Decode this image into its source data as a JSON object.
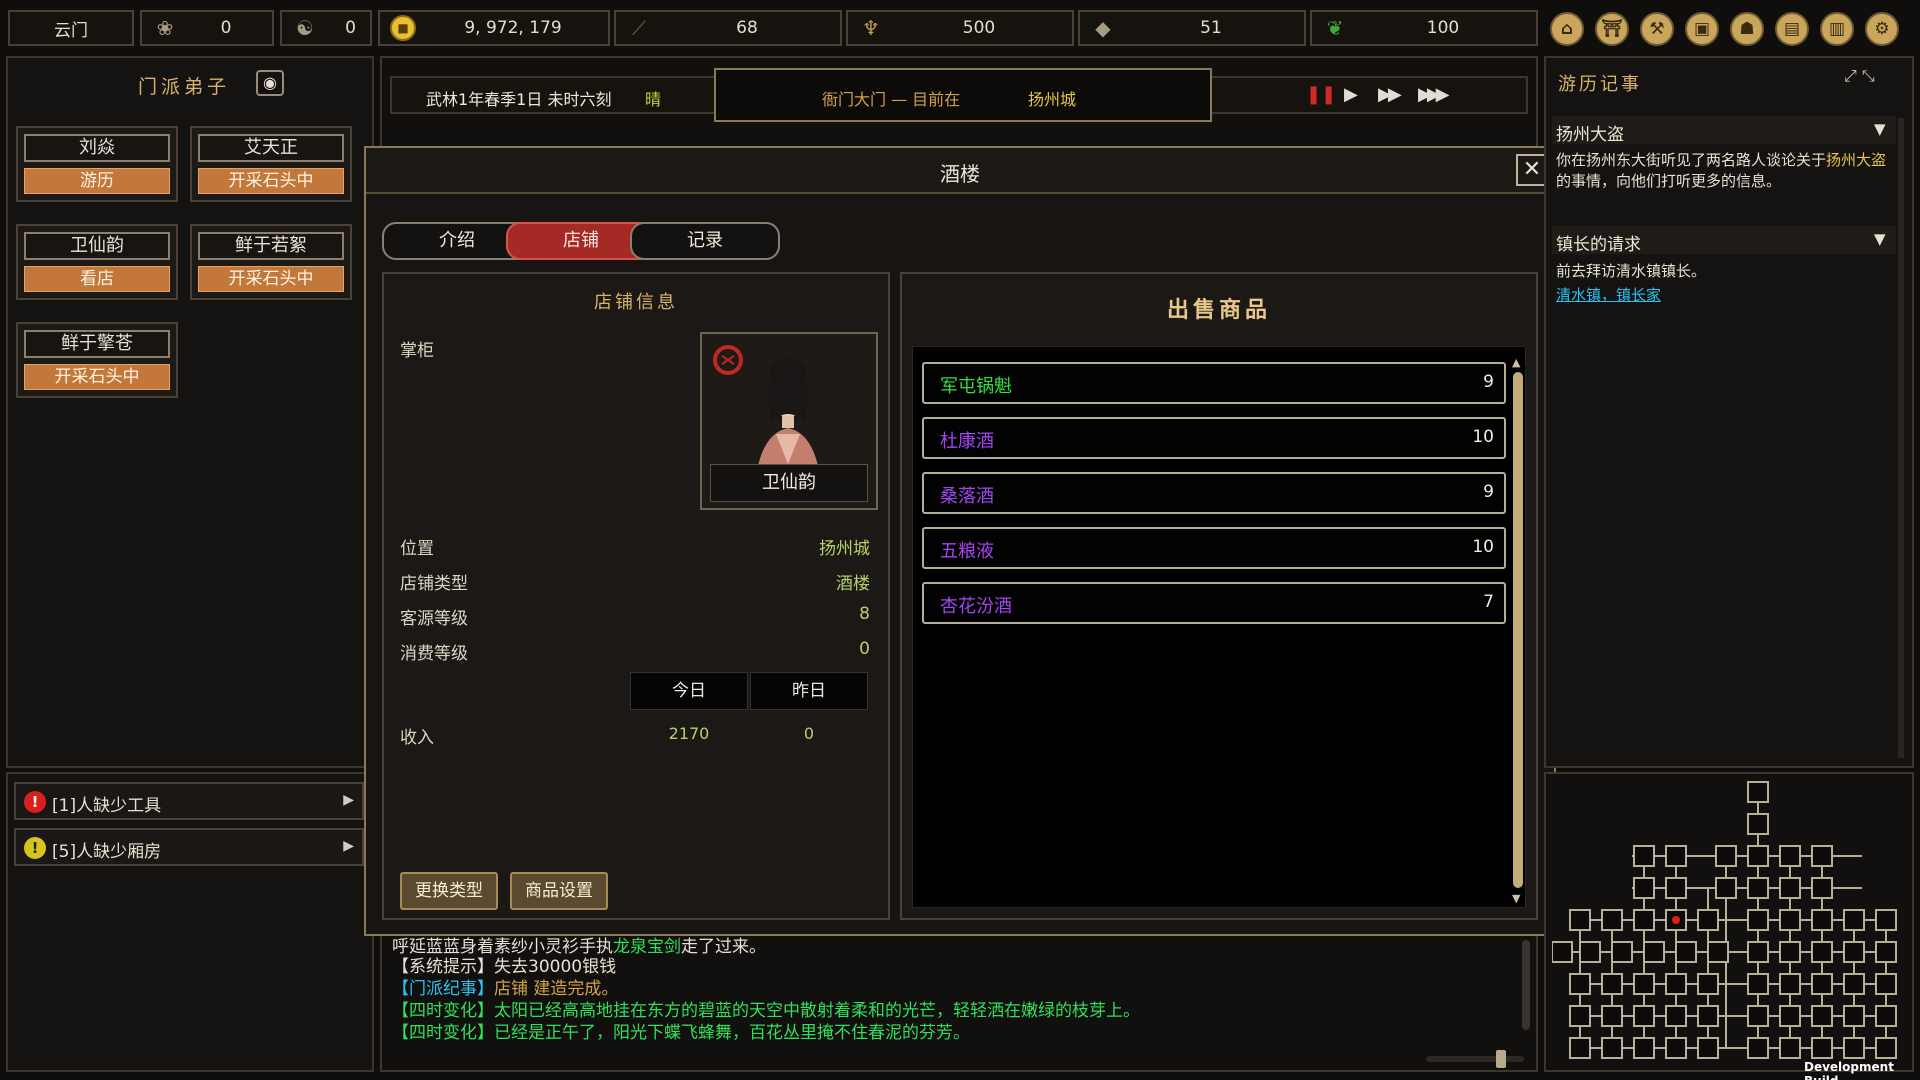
{
  "topbar": {
    "sect_name": "云门",
    "resources": [
      {
        "icon": "reputation-icon",
        "value": "0"
      },
      {
        "icon": "yinyang-icon",
        "value": "0"
      },
      {
        "icon": "coin-icon",
        "value": "9, 972, 179"
      },
      {
        "icon": "wood-icon",
        "value": "68"
      },
      {
        "icon": "grain-icon",
        "value": "500"
      },
      {
        "icon": "ore-icon",
        "value": "51"
      },
      {
        "icon": "herb-icon",
        "value": "100"
      }
    ],
    "menu_icons": [
      "sect-icon",
      "building-icon",
      "craft-icon",
      "map-icon",
      "bag-icon",
      "book-icon",
      "manual-icon",
      "settings-icon"
    ]
  },
  "disciples": {
    "title": "门派弟子",
    "items": [
      {
        "name": "刘焱",
        "status": "游历"
      },
      {
        "name": "艾天正",
        "status": "开采石头中"
      },
      {
        "name": "卫仙韵",
        "status": "看店"
      },
      {
        "name": "鲜于若絮",
        "status": "开采石头中"
      },
      {
        "name": "鲜于擎苍",
        "status": "开采石头中"
      }
    ]
  },
  "alerts": [
    {
      "text": "[1]人缺少工具",
      "color": "#d9201c"
    },
    {
      "text": "[5]人缺少厢房",
      "color": "#d7c31c"
    }
  ],
  "timebar": {
    "date": "武林1年春季1日  未时六刻",
    "weather": "晴",
    "location_prefix": "衙门大门  —  目前在",
    "city": "扬州城"
  },
  "dialog": {
    "title": "酒楼",
    "tabs": [
      "介绍",
      "店铺",
      "记录"
    ],
    "active_tab": "店铺",
    "shop_info_title": "店铺信息",
    "manager_label": "掌柜",
    "manager_name": "卫仙韵",
    "rows": [
      {
        "label": "位置",
        "value": "扬州城"
      },
      {
        "label": "店铺类型",
        "value": "酒楼"
      },
      {
        "label": "客源等级",
        "value": "8"
      },
      {
        "label": "消费等级",
        "value": "0"
      }
    ],
    "income_header": {
      "today": "今日",
      "yesterday": "昨日"
    },
    "income_label": "收入",
    "income_today": "2170",
    "income_yesterday": "0",
    "btn_change_type": "更换类型",
    "btn_goods_setting": "商品设置",
    "goods_title": "出售商品",
    "goods": [
      {
        "name": "军屯锅魁",
        "qty": "9",
        "color": "#33e046"
      },
      {
        "name": "杜康酒",
        "qty": "10",
        "color": "#a246f2"
      },
      {
        "name": "桑落酒",
        "qty": "9",
        "color": "#a246f2"
      },
      {
        "name": "五粮液",
        "qty": "10",
        "color": "#a246f2"
      },
      {
        "name": "杏花汾酒",
        "qty": "7",
        "color": "#a246f2"
      }
    ]
  },
  "log": {
    "partial": "呼延蓝蓝身着素纱小灵衫手执",
    "partial_item": "龙泉宝剑",
    "partial_end": "走了过来。",
    "lines": [
      {
        "tag": "【系统提示】",
        "text": "失去30000银钱",
        "tag_color": "#e8e0d0",
        "text_color": "#e8e0d0"
      },
      {
        "tag": "【门派纪事】",
        "text": "店铺  建造完成。",
        "tag_color": "#27c3f0",
        "text_color": "#e8e0d0"
      },
      {
        "tag": "【四时变化】",
        "text": "太阳已经高高地挂在东方的碧蓝的天空中散射着柔和的光芒，轻轻洒在嫩绿的枝芽上。",
        "tag_color": "#2ee05a",
        "text_color": "#2ee05a"
      },
      {
        "tag": "【四时变化】",
        "text": "已经是正午了，阳光下蝶飞蜂舞，百花丛里掩不住春泥的芬芳。",
        "tag_color": "#2ee05a",
        "text_color": "#2ee05a"
      }
    ]
  },
  "journal": {
    "title": "游历记事",
    "quests": [
      {
        "title": "扬州大盗",
        "desc_a": "你在扬州东大街听见了两名路人谈论关于",
        "highlight": "扬州大盗",
        "desc_b": "的事情，向他们打听更多的信息。"
      },
      {
        "title": "镇长的请求",
        "desc_a": "前去拜访清水镇镇长。",
        "link": "清水镇，镇长家"
      }
    ]
  },
  "footer": {
    "build": "Development Build"
  }
}
